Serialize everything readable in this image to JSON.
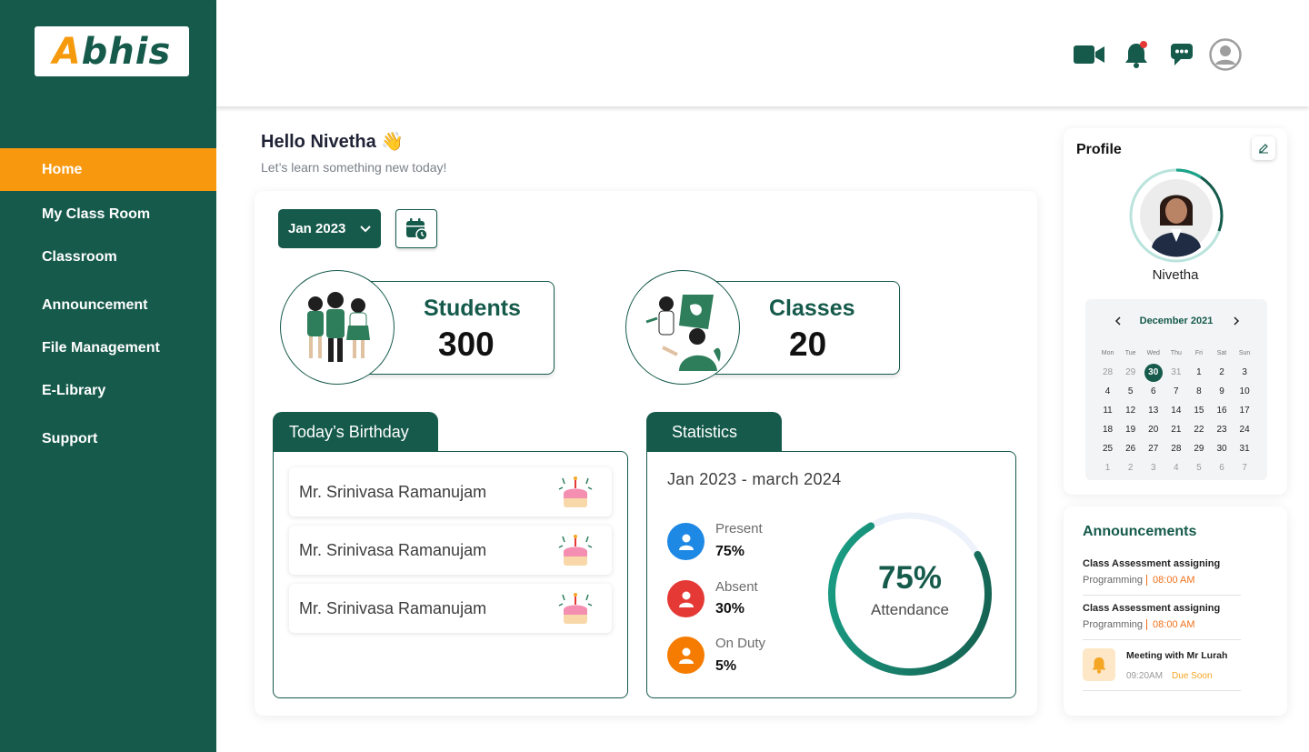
{
  "brand": {
    "logo_text_a": "A",
    "logo_text_rest": "bhis"
  },
  "sidebar": {
    "items": [
      {
        "label": "Home",
        "active": true
      },
      {
        "label": "My Class Room"
      },
      {
        "label": "Classroom"
      },
      {
        "label": "Announcement"
      },
      {
        "label": "File Management"
      },
      {
        "label": "E-Library"
      },
      {
        "label": "Support"
      }
    ]
  },
  "header": {
    "icons": [
      "video-camera-icon",
      "bell-icon",
      "chat-icon",
      "user-avatar-icon"
    ],
    "notification_dot_color": "#e53935"
  },
  "greeting": {
    "title": "Hello Nivetha 👋",
    "subtitle": "Let’s learn something new today!"
  },
  "filters": {
    "month": "Jan 2023"
  },
  "stats": {
    "students": {
      "label": "Students",
      "value": "300"
    },
    "classes": {
      "label": "Classes",
      "value": "20"
    }
  },
  "birthday": {
    "tab_label": "Today’s Birthday",
    "entries": [
      "Mr. Srinivasa Ramanujam",
      "Mr. Srinivasa Ramanujam",
      "Mr. Srinivasa Ramanujam"
    ]
  },
  "statistics": {
    "tab_label": "Statistics",
    "range": "Jan 2023 - march 2024",
    "rows": [
      {
        "label": "Present",
        "value": "75%",
        "color": "#1e88e5"
      },
      {
        "label": "Absent",
        "value": "30%",
        "color": "#e53935"
      },
      {
        "label": "On Duty",
        "value": "5%",
        "color": "#f57c00"
      }
    ],
    "gauge": {
      "percent_text": "75%",
      "label": "Attendance",
      "fraction": 0.75
    }
  },
  "profile": {
    "title": "Profile",
    "name": "Nivetha",
    "calendar": {
      "month": "December 2021",
      "weekdays": [
        "Mon",
        "Tue",
        "Wed",
        "Thu",
        "Fri",
        "Sat",
        "Sun"
      ],
      "weeks": [
        [
          "28",
          "29",
          "30",
          "31",
          "1",
          "2",
          "3"
        ],
        [
          "4",
          "5",
          "6",
          "7",
          "8",
          "9",
          "10"
        ],
        [
          "11",
          "12",
          "13",
          "14",
          "15",
          "16",
          "17"
        ],
        [
          "18",
          "19",
          "20",
          "21",
          "22",
          "23",
          "24"
        ],
        [
          "25",
          "26",
          "27",
          "28",
          "29",
          "30",
          "31"
        ],
        [
          "1",
          "2",
          "3",
          "4",
          "5",
          "6",
          "7"
        ]
      ],
      "selected": "30"
    }
  },
  "announcements": {
    "title": "Announcements",
    "items": [
      {
        "title": "Class Assessment assigning",
        "subject": "Programming",
        "time": "08:00 AM"
      },
      {
        "title": "Class Assessment assigning",
        "subject": "Programming",
        "time": "08:00 AM"
      }
    ],
    "reminder": {
      "title": "Meeting with Mr Lurah",
      "time": "09:20AM",
      "status": "Due Soon"
    }
  },
  "colors": {
    "primary": "#155a4b",
    "accent": "#f8980f"
  }
}
